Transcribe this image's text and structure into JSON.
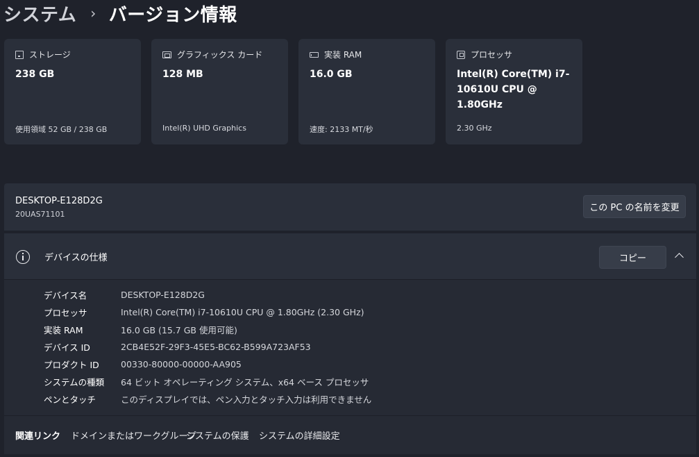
{
  "breadcrumb": {
    "parent": "システム",
    "separator": "›",
    "current": "バージョン情報"
  },
  "cards": [
    {
      "icon": "storage-icon",
      "title": "ストレージ",
      "value": "238 GB",
      "sub": "使用領域 52 GB / 238 GB"
    },
    {
      "icon": "graphics-card-icon",
      "title": "グラフィックス カード",
      "value": "128 MB",
      "sub": "Intel(R) UHD Graphics"
    },
    {
      "icon": "ram-icon",
      "title": "実装 RAM",
      "value": "16.0 GB",
      "sub": "速度: 2133 MT/秒"
    },
    {
      "icon": "processor-icon",
      "title": "プロセッサ",
      "value": "Intel(R) Core(TM) i7-10610U CPU @ 1.80GHz",
      "sub": "2.30 GHz"
    }
  ],
  "device": {
    "name": "DESKTOP-E128D2G",
    "model": "20UAS71101",
    "rename_label": "この PC の名前を変更"
  },
  "spec": {
    "title": "デバイスの仕様",
    "copy_label": "コピー",
    "rows": [
      {
        "label": "デバイス名",
        "value": "DESKTOP-E128D2G"
      },
      {
        "label": "プロセッサ",
        "value": "Intel(R) Core(TM) i7-10610U CPU @ 1.80GHz (2.30 GHz)"
      },
      {
        "label": "実装 RAM",
        "value": "16.0 GB (15.7 GB 使用可能)"
      },
      {
        "label": "デバイス ID",
        "value": "2CB4E52F-29F3-45E5-BC62-B599A723AF53"
      },
      {
        "label": "プロダクト ID",
        "value": "00330-80000-00000-AA905"
      },
      {
        "label": "システムの種類",
        "value": "64 ビット オペレーティング システム、x64 ベース プロセッサ"
      },
      {
        "label": "ペンとタッチ",
        "value": "このディスプレイでは、ペン入力とタッチ入力は利用できません"
      }
    ]
  },
  "related": {
    "title": "関連リンク",
    "links": [
      "ドメインまたはワークグループ",
      "システムの保護",
      "システムの詳細設定"
    ]
  },
  "colors": {
    "background": "#1f222b",
    "card": "#2a2f3a",
    "button": "#373d49"
  }
}
